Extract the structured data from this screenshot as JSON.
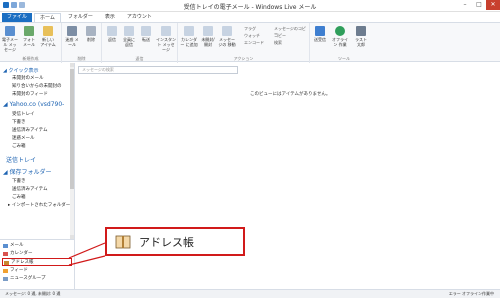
{
  "window": {
    "title": "受信トレイの電子メール - Windows Live メール"
  },
  "tabs": [
    "ファイル",
    "ホーム",
    "フォルダー",
    "表示",
    "アカウント"
  ],
  "ribbon": {
    "groups": [
      {
        "label": "新規作成",
        "buttons": [
          "電子メール メッセージ",
          "フォト メール",
          "新しい アイテム"
        ]
      },
      {
        "label": "削除",
        "buttons": [
          "迷惑 メール",
          "削除"
        ]
      },
      {
        "label": "返信",
        "buttons": [
          "返信",
          "全員に 返信",
          "転送",
          "インスタント メッセージ"
        ]
      },
      {
        "label": "アクション",
        "buttons": [
          "カレンダー に追加",
          "未開封/ 開封",
          "メッセージの 移動"
        ],
        "small": [
          "フラグ",
          "ウォッチ",
          "エンコード",
          "メッセージのコピー",
          "コピー",
          "検索"
        ]
      },
      {
        "label": "ツール",
        "buttons": [
          "送受信",
          "オフライン 作業",
          "ラスト 太郎"
        ]
      }
    ]
  },
  "sidebar": {
    "quick_views": {
      "title": "クイック表示",
      "items": [
        "未開封のメール",
        "知り合いからの未開封の",
        "未開封のフィード"
      ]
    },
    "account": {
      "title": "Yahoo.co (vsd790-",
      "items": [
        "受信トレイ",
        "下書き",
        "送信済みアイテム",
        "迷惑メール",
        "ごみ箱"
      ]
    },
    "outbox": "送信トレイ",
    "storage": {
      "title": "保存フォルダー",
      "items": [
        "下書き",
        "送信済みアイテム",
        "ごみ箱",
        "インポートされたフォルダー"
      ]
    },
    "nav": [
      "メール",
      "カレンダー",
      "アドレス帳",
      "フィード",
      "ニュースグループ"
    ]
  },
  "search": {
    "placeholder": "メッセージの検索"
  },
  "main": {
    "empty_message": "このビューにはアイテムがありません。"
  },
  "callout": {
    "label": "アドレス帳"
  },
  "status": {
    "left": "メッセージ: 0 通, 未開封: 0 通",
    "right": "エラー  オフライン作業中"
  }
}
